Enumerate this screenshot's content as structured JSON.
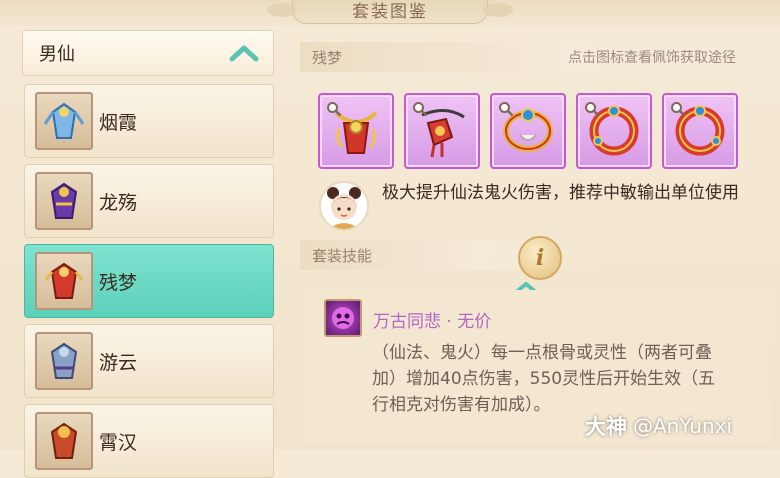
{
  "window": {
    "title": "套装图鉴"
  },
  "sidebar": {
    "header": "男仙",
    "items": [
      {
        "label": "烟霞",
        "icon": "outfit-yanxia-icon"
      },
      {
        "label": "龙殇",
        "icon": "outfit-longshang-icon"
      },
      {
        "label": "残梦",
        "icon": "outfit-canmeng-icon",
        "active": true
      },
      {
        "label": "游云",
        "icon": "outfit-youyun-icon"
      },
      {
        "label": "霄汉",
        "icon": "outfit-xiaohan-icon"
      }
    ]
  },
  "main": {
    "set_name": "残梦",
    "hint": "点击图标查看佩饰获取途径",
    "pieces": [
      "necklace",
      "belt-pendant",
      "ring",
      "bracelet-left",
      "bracelet-right"
    ],
    "description": "极大提升仙法鬼火伤害，推荐中敏输出单位使用",
    "skill_section_label": "套装技能",
    "skill": {
      "name": "万古同悲 · 无价",
      "description": "（仙法、鬼火）每一点根骨或灵性（两者可叠加）增加40点伤害，550灵性后开始生效（五行相克对伤害有加成）。"
    }
  },
  "watermark": {
    "brand": "大神",
    "handle": "@AnYunxi"
  },
  "colors": {
    "accent_teal": "#5cd0b9",
    "piece_border": "#c25ad6",
    "skill_name": "#b366c9"
  }
}
